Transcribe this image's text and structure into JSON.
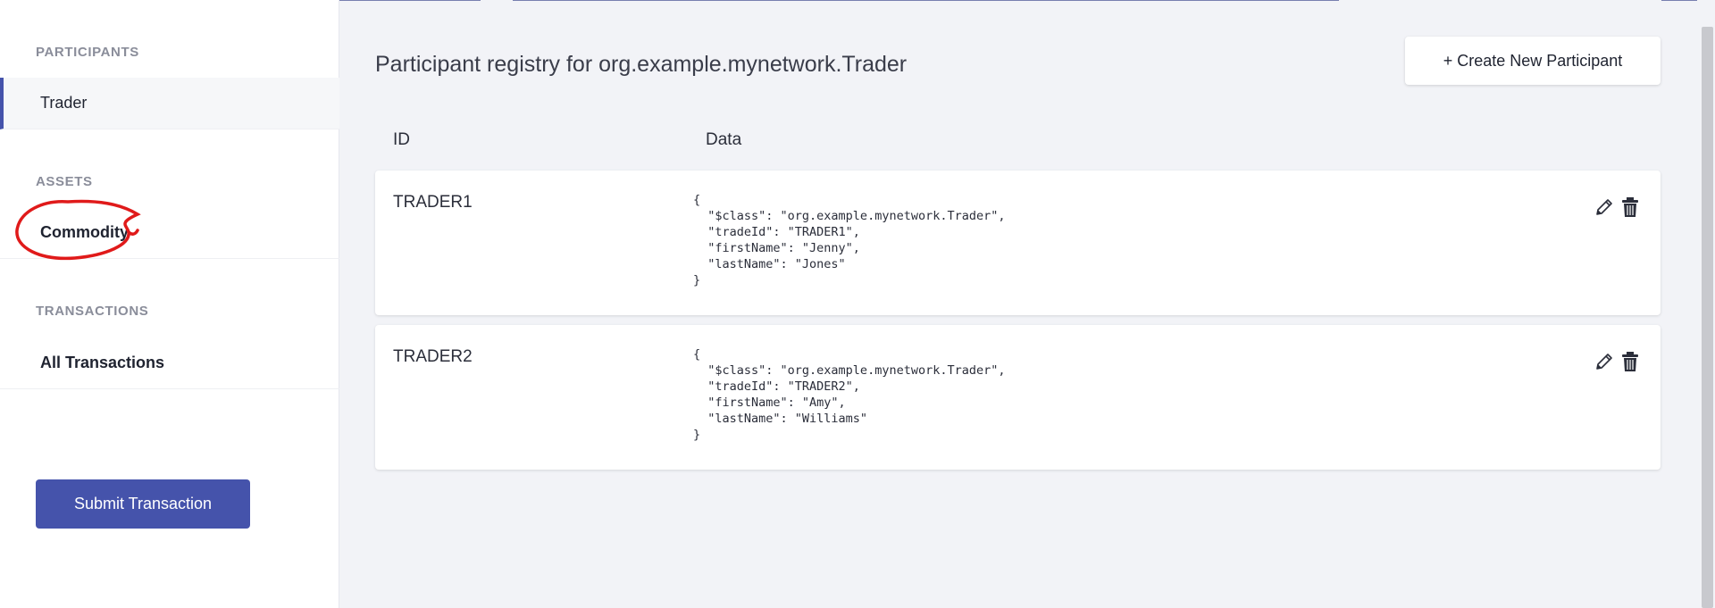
{
  "sidebar": {
    "participants_title": "PARTICIPANTS",
    "participants_items": [
      "Trader"
    ],
    "assets_title": "ASSETS",
    "assets_items": [
      "Commodity"
    ],
    "transactions_title": "TRANSACTIONS",
    "transactions_items": [
      "All Transactions"
    ],
    "submit_label": "Submit Transaction"
  },
  "main": {
    "title": "Participant registry for org.example.mynetwork.Trader",
    "create_label": "+ Create New Participant",
    "columns": {
      "id": "ID",
      "data": "Data"
    },
    "rows": [
      {
        "id": "TRADER1",
        "data": "{\n  \"$class\": \"org.example.mynetwork.Trader\",\n  \"tradeId\": \"TRADER1\",\n  \"firstName\": \"Jenny\",\n  \"lastName\": \"Jones\"\n}"
      },
      {
        "id": "TRADER2",
        "data": "{\n  \"$class\": \"org.example.mynetwork.Trader\",\n  \"tradeId\": \"TRADER2\",\n  \"firstName\": \"Amy\",\n  \"lastName\": \"Williams\"\n}"
      }
    ],
    "icons": {
      "edit": "pencil-icon",
      "delete": "trash-icon"
    }
  },
  "colors": {
    "accent": "#4553ab",
    "annotation": "#e01a1a",
    "background": "#f2f3f7"
  }
}
